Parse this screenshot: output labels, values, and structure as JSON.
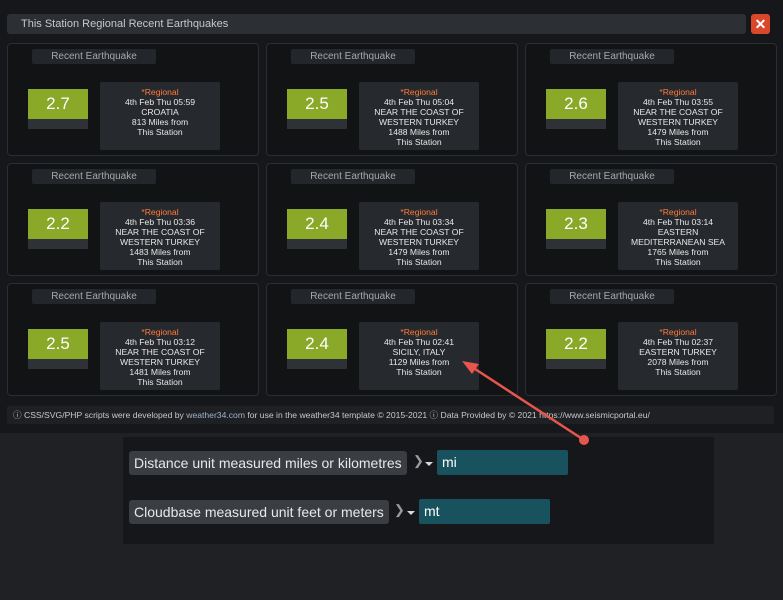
{
  "title": "This Station Regional Recent Earthquakes",
  "close_label": "✕",
  "quakes": [
    {
      "label": "Recent Earthquake",
      "mag": "2.7",
      "region": "*Regional",
      "date": "4th Feb Thu 05:59",
      "location": [
        "CROATIA"
      ],
      "distance": "813 Miles from",
      "station": "This Station"
    },
    {
      "label": "Recent Earthquake",
      "mag": "2.5",
      "region": "*Regional",
      "date": "4th Feb Thu 05:04",
      "location": [
        "NEAR THE COAST OF",
        "WESTERN TURKEY"
      ],
      "distance": "1488 Miles from",
      "station": "This Station"
    },
    {
      "label": "Recent Earthquake",
      "mag": "2.6",
      "region": "*Regional",
      "date": "4th Feb Thu 03:55",
      "location": [
        "NEAR THE COAST OF",
        "WESTERN TURKEY"
      ],
      "distance": "1479 Miles from",
      "station": "This Station"
    },
    {
      "label": "Recent Earthquake",
      "mag": "2.2",
      "region": "*Regional",
      "date": "4th Feb Thu 03:36",
      "location": [
        "NEAR THE COAST OF",
        "WESTERN TURKEY"
      ],
      "distance": "1483 Miles from",
      "station": "This Station"
    },
    {
      "label": "Recent Earthquake",
      "mag": "2.4",
      "region": "*Regional",
      "date": "4th Feb Thu 03:34",
      "location": [
        "NEAR THE COAST OF",
        "WESTERN TURKEY"
      ],
      "distance": "1479 Miles from",
      "station": "This Station"
    },
    {
      "label": "Recent Earthquake",
      "mag": "2.3",
      "region": "*Regional",
      "date": "4th Feb Thu 03:14",
      "location": [
        "EASTERN",
        "MEDITERRANEAN SEA"
      ],
      "distance": "1765 Miles from",
      "station": "This Station"
    },
    {
      "label": "Recent Earthquake",
      "mag": "2.5",
      "region": "*Regional",
      "date": "4th Feb Thu 03:12",
      "location": [
        "NEAR THE COAST OF",
        "WESTERN TURKEY"
      ],
      "distance": "1481 Miles from",
      "station": "This Station"
    },
    {
      "label": "Recent Earthquake",
      "mag": "2.4",
      "region": "*Regional",
      "date": "4th Feb Thu 02:41",
      "location": [
        "SICILY, ITALY"
      ],
      "distance": "1129 Miles from",
      "station": "This Station"
    },
    {
      "label": "Recent Earthquake",
      "mag": "2.2",
      "region": "*Regional",
      "date": "4th Feb Thu 02:37",
      "location": [
        "EASTERN TURKEY"
      ],
      "distance": "2078 Miles from",
      "station": "This Station"
    }
  ],
  "footer": {
    "prefix": "ⓘ CSS/SVG/PHP scripts were developed by",
    "link": "weather34.com",
    "middle": "for use in the weather34 template © 2015-2021",
    "data": "ⓘ Data Provided by © 2021 https://www.seismicportal.eu/"
  },
  "settings": [
    {
      "label": "Distance unit measured miles or kilometres",
      "value": "mi"
    },
    {
      "label": "Cloudbase measured unit feet or meters",
      "value": "mt"
    }
  ],
  "colors": {
    "magnitude": "#8aa928",
    "region": "#ff7b3a",
    "field": "#17525e",
    "close": "#d9482b",
    "arrow": "#e8554e"
  }
}
